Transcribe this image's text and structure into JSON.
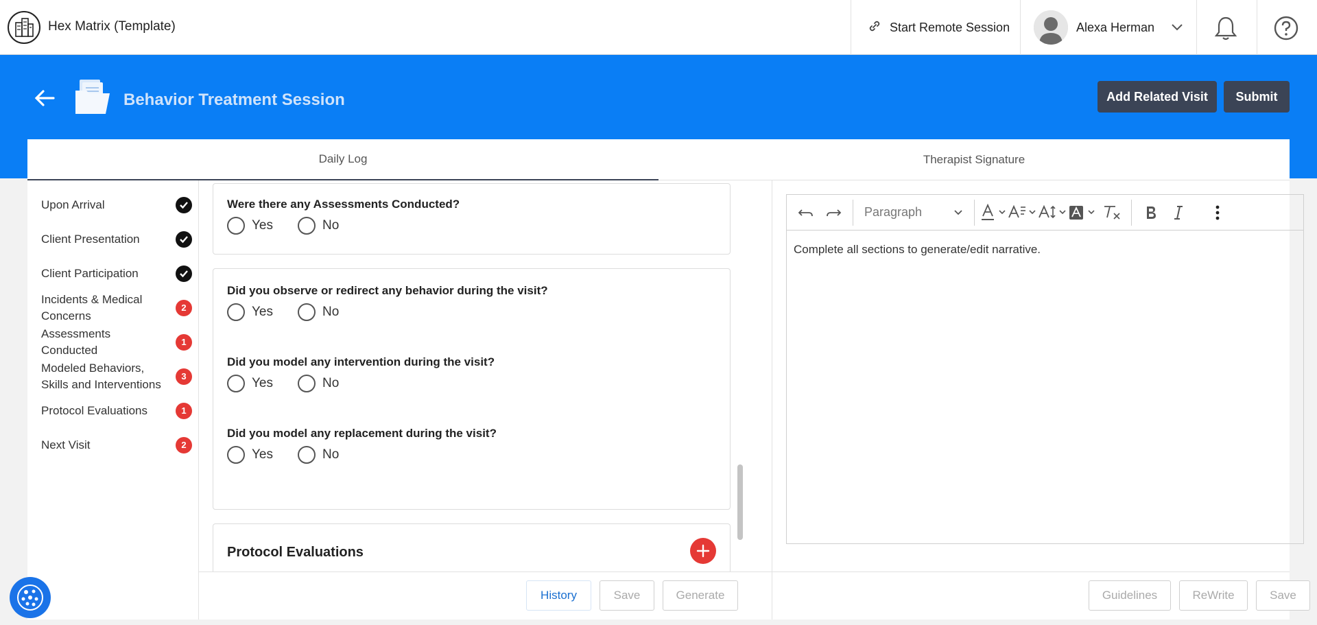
{
  "app": {
    "title": "Hex Matrix (Template)"
  },
  "topbar": {
    "remote_label": "Start Remote Session",
    "user_name": "Alexa Herman"
  },
  "header": {
    "title": "Behavior Treatment Session",
    "add_related_label": "Add Related Visit",
    "submit_label": "Submit"
  },
  "tabs": [
    {
      "label": "Daily Log",
      "active": true
    },
    {
      "label": "Therapist Signature",
      "active": false
    }
  ],
  "sidenav": {
    "items": [
      {
        "label": "Upon Arrival",
        "status": "complete"
      },
      {
        "label": "Client Presentation",
        "status": "complete"
      },
      {
        "label": "Client Participation",
        "status": "complete"
      },
      {
        "label": "Incidents & Medical Concerns",
        "badge": "2"
      },
      {
        "label": "Assessments Conducted",
        "badge": "1"
      },
      {
        "label": "Modeled Behaviors, Skills and Interventions",
        "badge": "3"
      },
      {
        "label": "Protocol Evaluations",
        "badge": "1"
      },
      {
        "label": "Next Visit",
        "badge": "2"
      }
    ]
  },
  "form": {
    "q_assessments": "Were there any Assessments Conducted?",
    "q_observe": "Did you observe or redirect any behavior during the visit?",
    "q_intervention": "Did you model any intervention during the visit?",
    "q_replacement": "Did you model any replacement during the visit?",
    "yes_label": "Yes",
    "no_label": "No",
    "protocol_title": "Protocol Evaluations"
  },
  "form_footer": {
    "history_label": "History",
    "save_label": "Save",
    "generate_label": "Generate"
  },
  "editor": {
    "format_select": "Paragraph",
    "body_text": "Complete all sections to generate/edit narrative."
  },
  "editor_footer": {
    "guidelines_label": "Guidelines",
    "rewrite_label": "ReWrite",
    "save_label": "Save"
  },
  "colors": {
    "brand_blue": "#0a7ef5",
    "dark_button": "#3b4456",
    "badge_red": "#e53935"
  }
}
